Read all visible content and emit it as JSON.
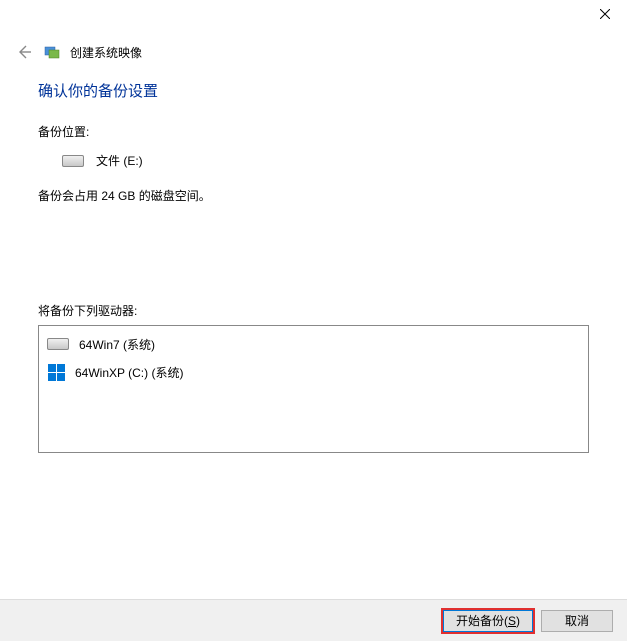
{
  "window": {
    "title": "创建系统映像"
  },
  "page": {
    "heading": "确认你的备份设置",
    "backup_location_label": "备份位置:",
    "backup_target": "文件 (E:)",
    "size_info": "备份会占用 24 GB 的磁盘空间。",
    "drives_label": "将备份下列驱动器:",
    "drives": [
      {
        "name": "64Win7  (系统)",
        "icon": "hdd"
      },
      {
        "name": "64WinXP  (C:) (系统)",
        "icon": "windows"
      }
    ]
  },
  "footer": {
    "start_label_prefix": "开始备份(",
    "start_label_key": "S",
    "start_label_suffix": ")",
    "cancel_label": "取消"
  }
}
